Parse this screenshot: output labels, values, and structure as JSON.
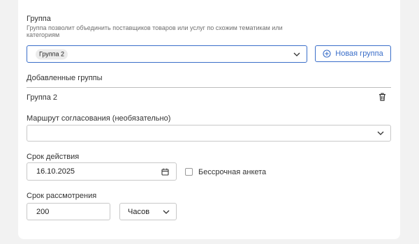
{
  "group": {
    "label": "Группа",
    "hint": "Группа позволит объединить поставщиков товаров или услуг по схожим тематикам или категориям",
    "selected_chip": "Группа 2",
    "new_group_button": "Новая группа"
  },
  "added_groups": {
    "label": "Добавленные группы",
    "items": [
      {
        "name": "Группа 2"
      }
    ]
  },
  "route": {
    "label": "Маршрут согласования (необязательно)",
    "value": ""
  },
  "validity": {
    "label": "Срок действия",
    "date_value": "16.10.2025",
    "indefinite_label": "Бессрочная анкета",
    "indefinite_checked": false
  },
  "review": {
    "label": "Срок рассмотрения",
    "value": "200",
    "unit": "Часов"
  },
  "colors": {
    "accent": "#3a6ec9",
    "background": "#f2f2f2"
  },
  "icons": {
    "chevron": "chevron-down-icon",
    "plus": "plus-circle-icon",
    "trash": "trash-icon",
    "calendar": "calendar-icon"
  }
}
